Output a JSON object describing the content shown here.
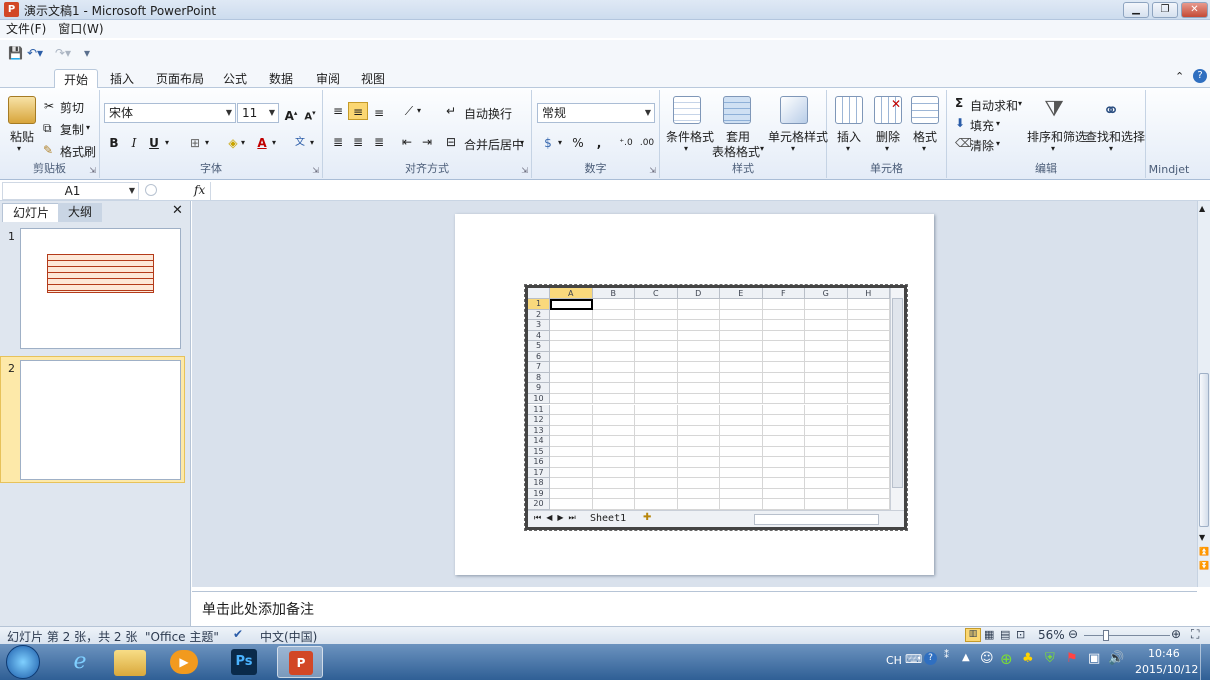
{
  "window": {
    "title": "演示文稿1 - Microsoft PowerPoint",
    "app_icon": "P"
  },
  "menu": [
    "文件(F)",
    "窗口(W)"
  ],
  "tabs": [
    "开始",
    "插入",
    "页面布局",
    "公式",
    "数据",
    "审阅",
    "视图"
  ],
  "ribbon": {
    "clipboard": {
      "paste": "粘贴",
      "cut": "剪切",
      "copy": "复制",
      "format_painter": "格式刷",
      "label": "剪贴板"
    },
    "font": {
      "name": "宋体",
      "size": "11",
      "label": "字体"
    },
    "alignment": {
      "wrap": "自动换行",
      "merge": "合并后居中",
      "label": "对齐方式"
    },
    "number": {
      "format": "常规",
      "label": "数字"
    },
    "styles": {
      "conditional": "条件格式",
      "table_line1": "套用",
      "table_line2": "表格格式",
      "cell_styles": "单元格样式",
      "label": "样式"
    },
    "cells": {
      "insert": "插入",
      "delete": "删除",
      "format": "格式",
      "label": "单元格"
    },
    "editing": {
      "autosum": "自动求和",
      "fill": "填充",
      "clear": "清除",
      "sort": "排序和筛选",
      "find": "查找和选择",
      "label": "编辑"
    },
    "mindjet": {
      "label": "Mindjet"
    }
  },
  "namebox": {
    "value": "A1",
    "fx": "fx"
  },
  "left_pane": {
    "tab_slides": "幻灯片",
    "tab_outline": "大纲",
    "slide1_num": "1",
    "slide2_num": "2"
  },
  "excel": {
    "columns": [
      "A",
      "B",
      "C",
      "D",
      "E",
      "F",
      "G",
      "H"
    ],
    "rows": [
      "1",
      "2",
      "3",
      "4",
      "5",
      "6",
      "7",
      "8",
      "9",
      "10",
      "11",
      "12",
      "13",
      "14",
      "15",
      "16",
      "17",
      "18",
      "19",
      "20"
    ],
    "sheet": "Sheet1"
  },
  "notes": {
    "placeholder": "单击此处添加备注"
  },
  "status": {
    "slide_info": "幻灯片 第 2 张，共 2 张",
    "theme": "\"Office 主题\"",
    "language": "中文(中国)",
    "zoom": "56%"
  },
  "tray": {
    "ime": "CH",
    "time": "10:46",
    "date": "2015/10/12"
  }
}
